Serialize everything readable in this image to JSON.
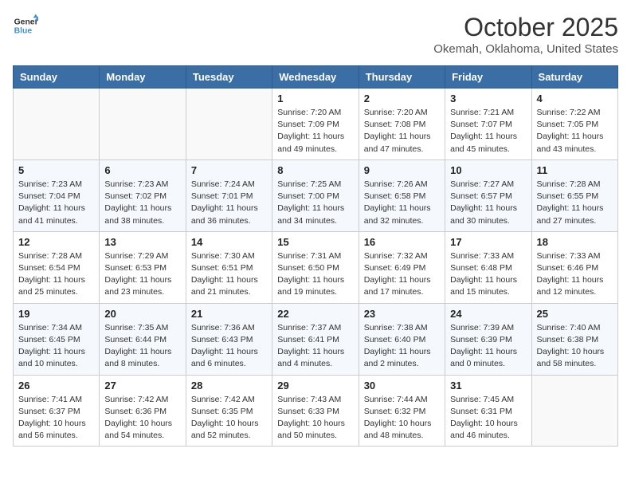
{
  "header": {
    "logo_line1": "General",
    "logo_line2": "Blue",
    "month": "October 2025",
    "location": "Okemah, Oklahoma, United States"
  },
  "weekdays": [
    "Sunday",
    "Monday",
    "Tuesday",
    "Wednesday",
    "Thursday",
    "Friday",
    "Saturday"
  ],
  "weeks": [
    [
      {
        "day": "",
        "info": ""
      },
      {
        "day": "",
        "info": ""
      },
      {
        "day": "",
        "info": ""
      },
      {
        "day": "1",
        "info": "Sunrise: 7:20 AM\nSunset: 7:09 PM\nDaylight: 11 hours\nand 49 minutes."
      },
      {
        "day": "2",
        "info": "Sunrise: 7:20 AM\nSunset: 7:08 PM\nDaylight: 11 hours\nand 47 minutes."
      },
      {
        "day": "3",
        "info": "Sunrise: 7:21 AM\nSunset: 7:07 PM\nDaylight: 11 hours\nand 45 minutes."
      },
      {
        "day": "4",
        "info": "Sunrise: 7:22 AM\nSunset: 7:05 PM\nDaylight: 11 hours\nand 43 minutes."
      }
    ],
    [
      {
        "day": "5",
        "info": "Sunrise: 7:23 AM\nSunset: 7:04 PM\nDaylight: 11 hours\nand 41 minutes."
      },
      {
        "day": "6",
        "info": "Sunrise: 7:23 AM\nSunset: 7:02 PM\nDaylight: 11 hours\nand 38 minutes."
      },
      {
        "day": "7",
        "info": "Sunrise: 7:24 AM\nSunset: 7:01 PM\nDaylight: 11 hours\nand 36 minutes."
      },
      {
        "day": "8",
        "info": "Sunrise: 7:25 AM\nSunset: 7:00 PM\nDaylight: 11 hours\nand 34 minutes."
      },
      {
        "day": "9",
        "info": "Sunrise: 7:26 AM\nSunset: 6:58 PM\nDaylight: 11 hours\nand 32 minutes."
      },
      {
        "day": "10",
        "info": "Sunrise: 7:27 AM\nSunset: 6:57 PM\nDaylight: 11 hours\nand 30 minutes."
      },
      {
        "day": "11",
        "info": "Sunrise: 7:28 AM\nSunset: 6:55 PM\nDaylight: 11 hours\nand 27 minutes."
      }
    ],
    [
      {
        "day": "12",
        "info": "Sunrise: 7:28 AM\nSunset: 6:54 PM\nDaylight: 11 hours\nand 25 minutes."
      },
      {
        "day": "13",
        "info": "Sunrise: 7:29 AM\nSunset: 6:53 PM\nDaylight: 11 hours\nand 23 minutes."
      },
      {
        "day": "14",
        "info": "Sunrise: 7:30 AM\nSunset: 6:51 PM\nDaylight: 11 hours\nand 21 minutes."
      },
      {
        "day": "15",
        "info": "Sunrise: 7:31 AM\nSunset: 6:50 PM\nDaylight: 11 hours\nand 19 minutes."
      },
      {
        "day": "16",
        "info": "Sunrise: 7:32 AM\nSunset: 6:49 PM\nDaylight: 11 hours\nand 17 minutes."
      },
      {
        "day": "17",
        "info": "Sunrise: 7:33 AM\nSunset: 6:48 PM\nDaylight: 11 hours\nand 15 minutes."
      },
      {
        "day": "18",
        "info": "Sunrise: 7:33 AM\nSunset: 6:46 PM\nDaylight: 11 hours\nand 12 minutes."
      }
    ],
    [
      {
        "day": "19",
        "info": "Sunrise: 7:34 AM\nSunset: 6:45 PM\nDaylight: 11 hours\nand 10 minutes."
      },
      {
        "day": "20",
        "info": "Sunrise: 7:35 AM\nSunset: 6:44 PM\nDaylight: 11 hours\nand 8 minutes."
      },
      {
        "day": "21",
        "info": "Sunrise: 7:36 AM\nSunset: 6:43 PM\nDaylight: 11 hours\nand 6 minutes."
      },
      {
        "day": "22",
        "info": "Sunrise: 7:37 AM\nSunset: 6:41 PM\nDaylight: 11 hours\nand 4 minutes."
      },
      {
        "day": "23",
        "info": "Sunrise: 7:38 AM\nSunset: 6:40 PM\nDaylight: 11 hours\nand 2 minutes."
      },
      {
        "day": "24",
        "info": "Sunrise: 7:39 AM\nSunset: 6:39 PM\nDaylight: 11 hours\nand 0 minutes."
      },
      {
        "day": "25",
        "info": "Sunrise: 7:40 AM\nSunset: 6:38 PM\nDaylight: 10 hours\nand 58 minutes."
      }
    ],
    [
      {
        "day": "26",
        "info": "Sunrise: 7:41 AM\nSunset: 6:37 PM\nDaylight: 10 hours\nand 56 minutes."
      },
      {
        "day": "27",
        "info": "Sunrise: 7:42 AM\nSunset: 6:36 PM\nDaylight: 10 hours\nand 54 minutes."
      },
      {
        "day": "28",
        "info": "Sunrise: 7:42 AM\nSunset: 6:35 PM\nDaylight: 10 hours\nand 52 minutes."
      },
      {
        "day": "29",
        "info": "Sunrise: 7:43 AM\nSunset: 6:33 PM\nDaylight: 10 hours\nand 50 minutes."
      },
      {
        "day": "30",
        "info": "Sunrise: 7:44 AM\nSunset: 6:32 PM\nDaylight: 10 hours\nand 48 minutes."
      },
      {
        "day": "31",
        "info": "Sunrise: 7:45 AM\nSunset: 6:31 PM\nDaylight: 10 hours\nand 46 minutes."
      },
      {
        "day": "",
        "info": ""
      }
    ]
  ]
}
